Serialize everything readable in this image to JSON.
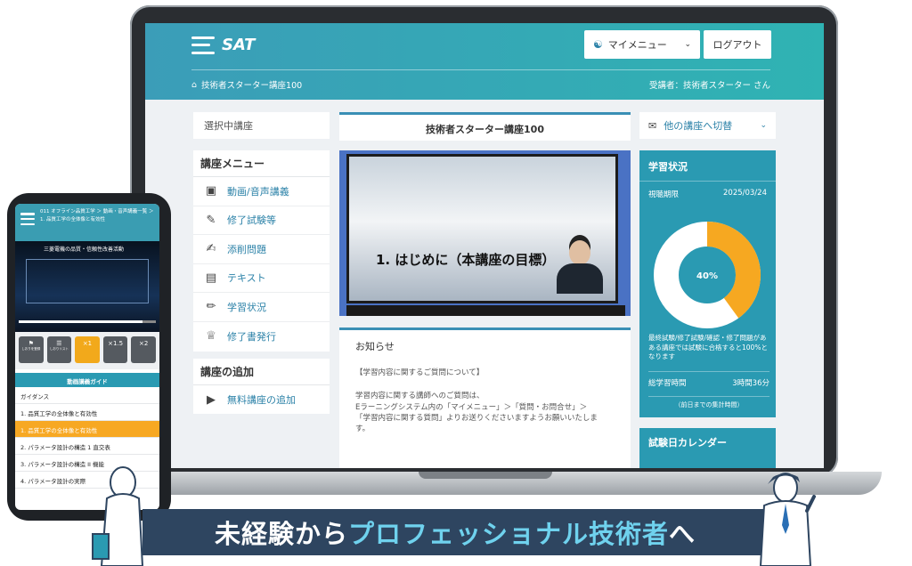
{
  "app": {
    "logo_text": "SAT",
    "menu_button_label": "マイメニュー",
    "logout_label": "ログアウト",
    "breadcrumb": "技術者スターター講座100",
    "user_label": "受講者：技術者スターター さん"
  },
  "left": {
    "selected_course_label": "選択中講座",
    "menu_title": "講座メニュー",
    "menu_items": [
      {
        "label": "動画/音声講義",
        "icon": "video-lecture-icon"
      },
      {
        "label": "修了試験等",
        "icon": "exam-icon"
      },
      {
        "label": "添削問題",
        "icon": "correction-icon"
      },
      {
        "label": "テキスト",
        "icon": "text-book-icon"
      },
      {
        "label": "学習状況",
        "icon": "pencil-icon"
      },
      {
        "label": "修了書発行",
        "icon": "trophy-icon"
      }
    ],
    "add_title": "講座の追加",
    "add_item": "無料講座の追加"
  },
  "center": {
    "course_title": "技術者スターター講座100",
    "video_title": "1. はじめに（本講座の目標）",
    "news_title": "お知らせ",
    "news_lines": [
      "【学習内容に関するご質問について】",
      "学習内容に関する講師へのご質問は、",
      "Eラーニングシステム内の「マイメニュー」＞「質問・お問合せ」＞",
      "「学習内容に関する質問」よりお送りくださいますようお願いいたしま",
      "す。"
    ]
  },
  "right": {
    "switch_label": "他の講座へ切替",
    "status_title": "学習状況",
    "period_label": "視聴期限",
    "period_value": "2025/03/24",
    "progress_percent": 40,
    "progress_label": "40%",
    "progress_note": "最終試験/修了試験/確認・修了問題があある講座では試験に合格すると100%となります",
    "total_label": "総学習時間",
    "total_value": "3時間36分",
    "total_foot": "（前日までの集計時間）",
    "calendar_title": "試験日カレンダー",
    "colors": {
      "accent": "#f6a821",
      "ring": "#ffffff",
      "center": "#2a9ab2"
    }
  },
  "phone": {
    "breadcrumb_line1": "011 オフライン品質工学 ＞ 動画・音声講義一覧 ＞",
    "breadcrumb_line2": "1. 品質工学の全体像と有効性",
    "video_title": "三菱電機の品質・信頼性改善活動",
    "controls": [
      "しおりを登録",
      "しおりリスト",
      "×1",
      "×1.5",
      "×2"
    ],
    "active_speed": "×1",
    "guide_title": "動画講義ガイド",
    "list": [
      "ガイダンス",
      "1. 品質工学の全体像と有効性",
      "1. 品質工学の全体像と有効性",
      "2. パラメータ設計の構造 1 直交表",
      "3. パラメータ設計の構造 II 機能",
      "4. パラメータ設計の実際"
    ]
  },
  "banner": {
    "prefix": "未経験から",
    "highlight": "プロフェッショナル技術者",
    "suffix": "へ"
  }
}
